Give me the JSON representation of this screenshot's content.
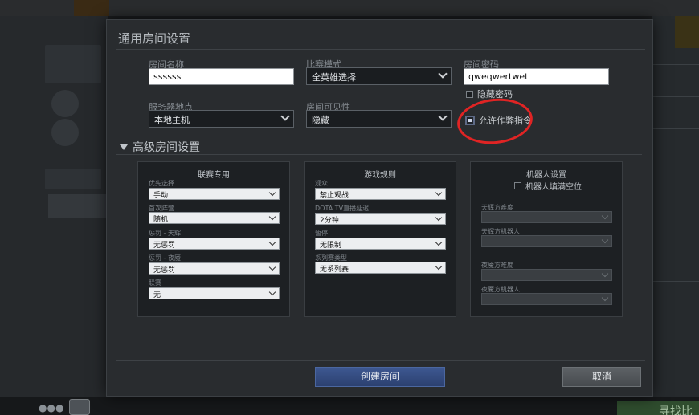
{
  "dialog": {
    "title": "通用房间设置",
    "room_name": {
      "label": "房间名称",
      "value": "ssssss"
    },
    "game_mode": {
      "label": "比赛模式",
      "value": "全英雄选择"
    },
    "password": {
      "label": "房间密码",
      "value": "qweqwertwet",
      "hide_label": "隐藏密码"
    },
    "server": {
      "label": "服务器地点",
      "value": "本地主机"
    },
    "visibility": {
      "label": "房间可见性",
      "value": "隐藏"
    },
    "cheats": {
      "label": "允许作弊指令"
    },
    "advanced_title": "高级房间设置",
    "panels": {
      "league": {
        "title": "联赛专用",
        "fields": [
          {
            "label": "优先选择",
            "value": "手动"
          },
          {
            "label": "首次阵营",
            "value": "随机"
          },
          {
            "label": "惩罚 - 天辉",
            "value": "无惩罚"
          },
          {
            "label": "惩罚 - 夜魇",
            "value": "无惩罚"
          },
          {
            "label": "联赛",
            "value": "无"
          }
        ]
      },
      "rules": {
        "title": "游戏规则",
        "fields": [
          {
            "label": "观众",
            "value": "禁止观战"
          },
          {
            "label": "DOTA TV直播延迟",
            "value": "2分钟"
          },
          {
            "label": "暂停",
            "value": "无限制"
          },
          {
            "label": "系列赛类型",
            "value": "无系列赛"
          }
        ]
      },
      "bots": {
        "title": "机器人设置",
        "fill_label": "机器人填满空位",
        "fields": [
          {
            "label": "天辉方难度"
          },
          {
            "label": "天辉方机器人"
          },
          {
            "label": "夜魇方难度"
          },
          {
            "label": "夜魇方机器人"
          }
        ]
      }
    },
    "create_label": "创建房间",
    "cancel_label": "取消"
  },
  "background": {
    "find_match": "寻找比"
  }
}
